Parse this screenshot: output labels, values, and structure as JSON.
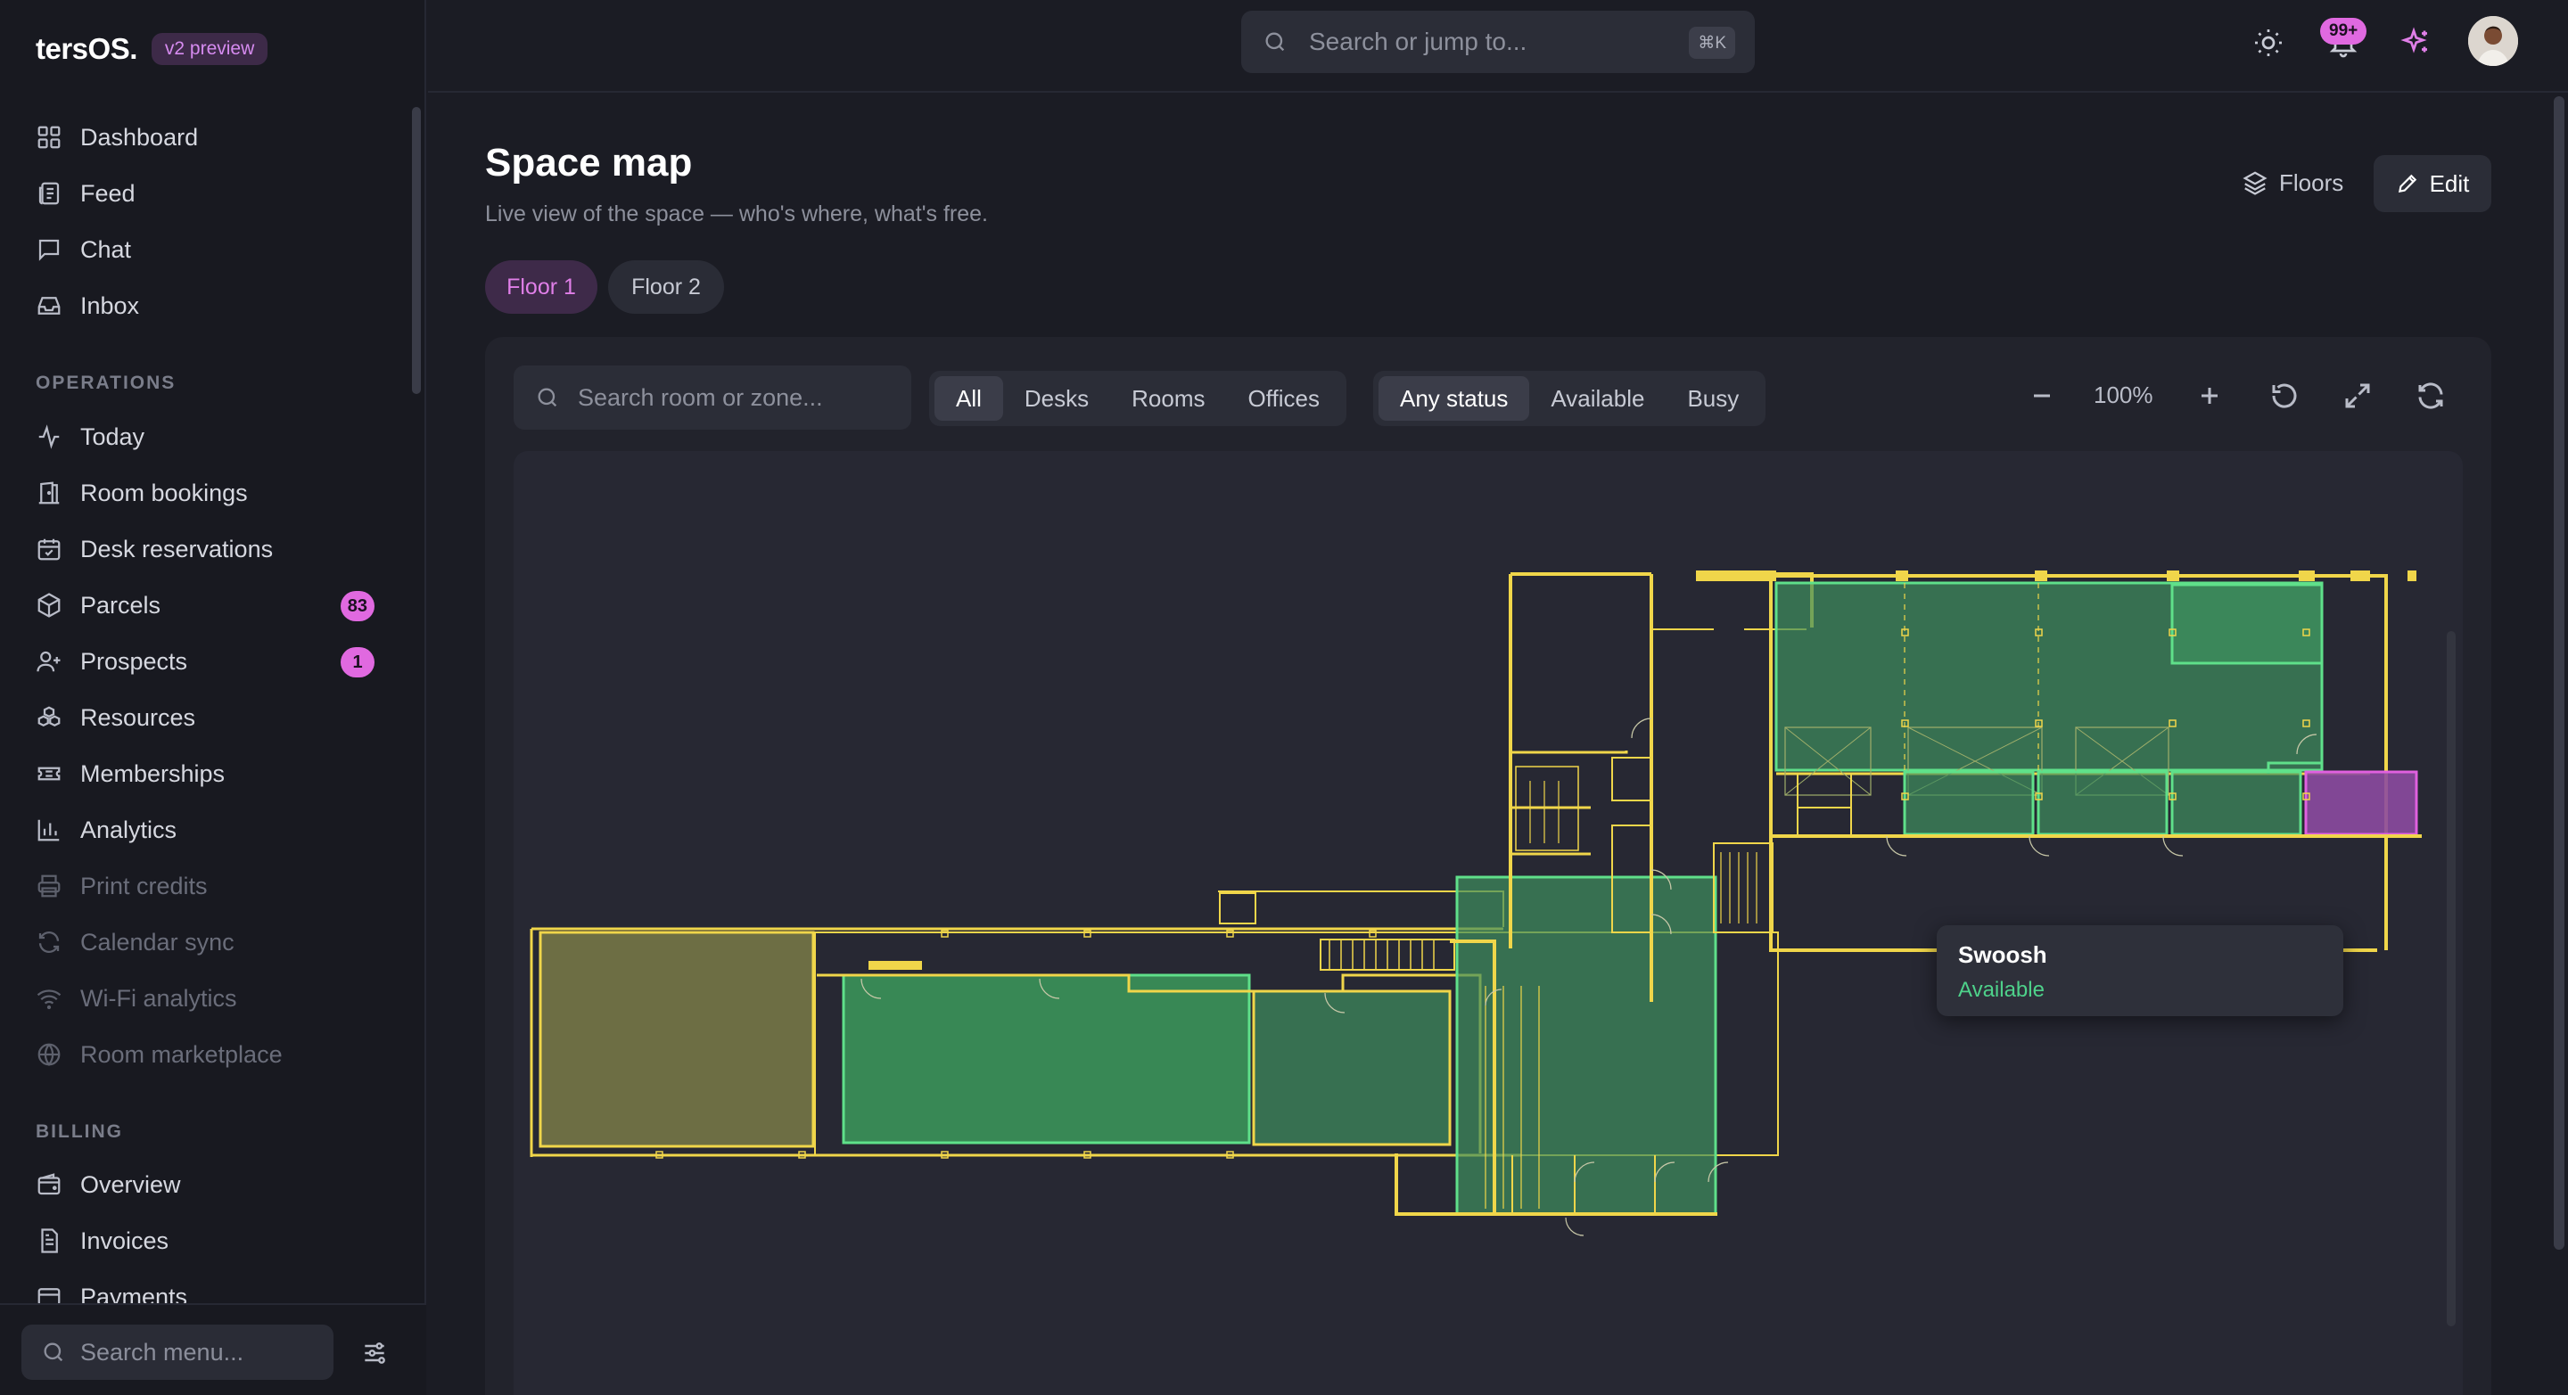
{
  "brand": {
    "name": "tersOS.",
    "badge": "v2 preview"
  },
  "nav": {
    "main": [
      {
        "label": "Dashboard",
        "icon": "dashboard-grid-icon"
      },
      {
        "label": "Feed",
        "icon": "feed-icon"
      },
      {
        "label": "Chat",
        "icon": "chat-bubble-icon"
      },
      {
        "label": "Inbox",
        "icon": "inbox-tray-icon"
      }
    ],
    "operations_label": "OPERATIONS",
    "operations": [
      {
        "label": "Today",
        "icon": "activity-icon"
      },
      {
        "label": "Room bookings",
        "icon": "door-icon"
      },
      {
        "label": "Desk reservations",
        "icon": "calendar-check-icon"
      },
      {
        "label": "Parcels",
        "icon": "package-icon",
        "count": "83"
      },
      {
        "label": "Prospects",
        "icon": "user-plus-icon",
        "count": "1"
      },
      {
        "label": "Resources",
        "icon": "boxes-icon"
      },
      {
        "label": "Memberships",
        "icon": "ticket-icon"
      },
      {
        "label": "Analytics",
        "icon": "bar-chart-icon"
      },
      {
        "label": "Print credits",
        "icon": "printer-icon",
        "disabled": true
      },
      {
        "label": "Calendar sync",
        "icon": "refresh-icon",
        "disabled": true
      },
      {
        "label": "Wi-Fi analytics",
        "icon": "wifi-icon",
        "disabled": true
      },
      {
        "label": "Room marketplace",
        "icon": "globe-icon",
        "disabled": true
      }
    ],
    "billing_label": "BILLING",
    "billing": [
      {
        "label": "Overview",
        "icon": "wallet-icon"
      },
      {
        "label": "Invoices",
        "icon": "invoice-icon"
      },
      {
        "label": "Payments",
        "icon": "payment-icon"
      }
    ],
    "search_placeholder": "Search menu..."
  },
  "topbar": {
    "search_placeholder": "Search or jump to...",
    "shortcut": "⌘K",
    "notifications_count": "99+"
  },
  "page": {
    "title": "Space map",
    "subtitle": "Live view of the space — who's where, what's free.",
    "floors_label": "Floors",
    "edit_label": "Edit",
    "floor_tabs": [
      "Floor 1",
      "Floor 2"
    ],
    "active_floor": "Floor 1"
  },
  "map": {
    "search_placeholder": "Search room or zone...",
    "type_filters": [
      "All",
      "Desks",
      "Rooms",
      "Offices"
    ],
    "active_type": "All",
    "status_filters": [
      "Any status",
      "Available",
      "Busy"
    ],
    "active_status": "Any status",
    "zoom": "100%",
    "colors": {
      "wall": "#f0d64a",
      "available": "#3e8f5e",
      "selected": "#3fa862",
      "reserved": "#7a7a48",
      "busy": "#8c4aa0"
    },
    "tooltip": {
      "title": "Swoosh",
      "status": "Available"
    }
  }
}
